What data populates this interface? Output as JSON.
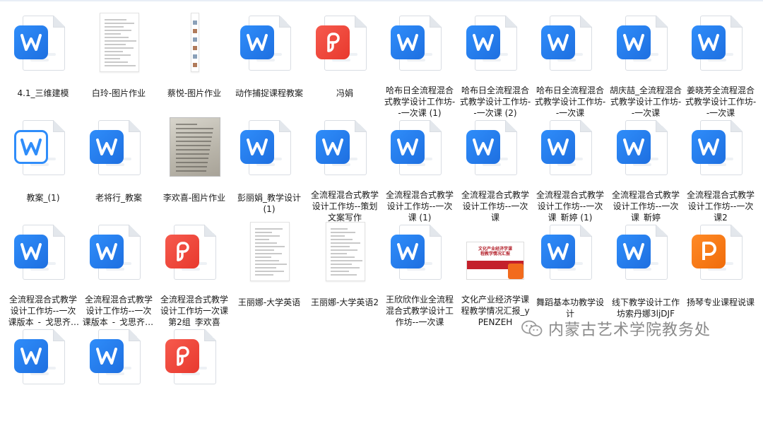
{
  "files": [
    {
      "name": "4.1_三维建模",
      "type": "word"
    },
    {
      "name": "白玲-图片作业",
      "type": "image-doc"
    },
    {
      "name": "蔡悦-图片作业",
      "type": "image-strip"
    },
    {
      "name": "动作捕捉课程教案",
      "type": "word"
    },
    {
      "name": "冯娟",
      "type": "pdf"
    },
    {
      "name": "哈布日全流程混合式教学设计工作坊--一次课 (1)",
      "type": "word"
    },
    {
      "name": "哈布日全流程混合式教学设计工作坊--一次课 (2)",
      "type": "word"
    },
    {
      "name": "哈布日全流程混合式教学设计工作坊--一次课",
      "type": "word"
    },
    {
      "name": "胡庆喆_全流程混合式教学设计工作坊--一次课",
      "type": "word"
    },
    {
      "name": "姜晓芳全流程混合式教学设计工作坊--一次课",
      "type": "word"
    },
    {
      "name": "教案_(1)",
      "type": "word-outline"
    },
    {
      "name": "老将行_教案",
      "type": "word"
    },
    {
      "name": "李欢喜-图片作业",
      "type": "photo"
    },
    {
      "name": "彭丽娟_教学设计 (1)",
      "type": "word"
    },
    {
      "name": "全流程混合式教学设计工作坊--策划文案写作",
      "type": "word"
    },
    {
      "name": "全流程混合式教学设计工作坊--一次课 (1)",
      "type": "word"
    },
    {
      "name": "全流程混合式教学设计工作坊--一次课",
      "type": "word"
    },
    {
      "name": "全流程混合式教学设计工作坊--一次课_靳婷 (1)",
      "type": "word"
    },
    {
      "name": "全流程混合式教学设计工作坊--一次课_靳婷",
      "type": "word"
    },
    {
      "name": "全流程混合式教学设计工作坊--一次课2",
      "type": "word"
    },
    {
      "name": "全流程混合式教学设计工作坊--一次课版本_-_戈思齐_-_0512_B...",
      "type": "word"
    },
    {
      "name": "全流程混合式教学设计工作坊--一次课版本_-_戈思齐_AU0PmbS",
      "type": "word"
    },
    {
      "name": "全流程混合式教学设计工作坊一次课第2组_李欢喜",
      "type": "pdf"
    },
    {
      "name": "王丽娜-大学英语",
      "type": "image-doc"
    },
    {
      "name": "王丽娜-大学英语2",
      "type": "image-doc"
    },
    {
      "name": "王欣欣作业全流程混合式教学设计工作坊--一次课",
      "type": "word"
    },
    {
      "name": "文化产业经济学课程教学情况汇报_yPENZEH",
      "type": "poster"
    },
    {
      "name": "舞蹈基本功教学设计",
      "type": "word"
    },
    {
      "name": "线下教学设计工作坊索丹娜3ljDJF",
      "type": "word"
    },
    {
      "name": "扬琴专业课程说课",
      "type": "ppt"
    },
    {
      "name": "",
      "type": "word"
    },
    {
      "name": "",
      "type": "word"
    },
    {
      "name": "",
      "type": "pdf"
    }
  ],
  "poster_text": "文化产业经济学课程教学情况汇报",
  "watermark": "内蒙古艺术学院教务处",
  "colors": {
    "word": "#2f8dfa",
    "pdf": "#e8392e",
    "ppt": "#f06c0a"
  }
}
